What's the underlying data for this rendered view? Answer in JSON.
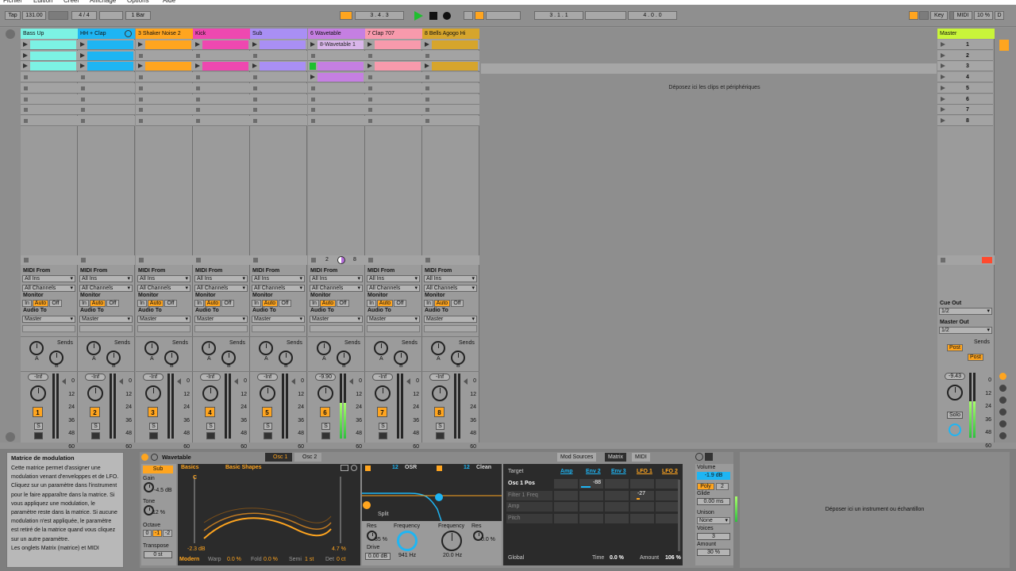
{
  "menu": [
    "Fichier",
    "Édition",
    "Créer",
    "Affichage",
    "Options",
    "Aide"
  ],
  "transport": {
    "tap": "Tap",
    "tempo": "131.00",
    "sig": "4 / 4",
    "rec_mode": "1 Bar",
    "position": "3 . 4 . 3",
    "loop_start": "3 . 1 . 1",
    "loop_len": "4 . 0 . 0",
    "key": "Key",
    "midi": "MIDI",
    "cpu": "10 %",
    "d": "D"
  },
  "tracks": [
    {
      "name": "Bass Up",
      "color": "#7cf2e4",
      "num": "1",
      "vol": "-Inf",
      "clips": [
        0,
        1,
        2
      ],
      "clip_label": ""
    },
    {
      "name": "HH + Clap",
      "color": "#1eb5f3",
      "num": "2",
      "vol": "-Inf",
      "clips": [
        0,
        1,
        2
      ],
      "clip_label": ""
    },
    {
      "name": "3 Shaker Noise 2",
      "color": "#ffa51f",
      "num": "3",
      "vol": "-Inf",
      "clips": [
        0,
        2
      ],
      "clip_label": ""
    },
    {
      "name": "Kick",
      "color": "#ee48b0",
      "num": "4",
      "vol": "-Inf",
      "clips": [
        0,
        2
      ],
      "clip_label": ""
    },
    {
      "name": "Sub",
      "color": "#a98ff4",
      "num": "5",
      "vol": "-Inf",
      "clips": [
        0,
        2
      ],
      "clip_label": ""
    },
    {
      "name": "6 Wavetable",
      "color": "#c57fe2",
      "num": "6",
      "vol": "-9.90",
      "clips": [
        0,
        2,
        3
      ],
      "clip_label": "8-Wavetable 1"
    },
    {
      "name": "7 Clap 707",
      "color": "#f89aac",
      "num": "7",
      "vol": "-Inf",
      "clips": [
        0,
        2
      ],
      "clip_label": ""
    },
    {
      "name": "8 Bells Agogo Hi",
      "color": "#d6a52c",
      "num": "8",
      "vol": "-Inf",
      "clips": [
        0,
        2
      ],
      "clip_label": ""
    }
  ],
  "io": {
    "midi_from": "MIDI From",
    "all_ins": "All Ins",
    "all_channels": "All Channels",
    "monitor": "Monitor",
    "in": "In",
    "auto": "Auto",
    "off": "Off",
    "audio_to": "Audio To",
    "master": "Master",
    "sends": "Sends",
    "a": "A",
    "b": "B",
    "s": "S"
  },
  "scale": [
    "0",
    "12",
    "24",
    "36",
    "48",
    "60"
  ],
  "wavetable_status": {
    "left": "2",
    "right": "8"
  },
  "drop_text": "Déposez ici les clips et périphériques",
  "master": {
    "name": "Master",
    "scenes": [
      "1",
      "2",
      "3",
      "4",
      "5",
      "6",
      "7",
      "8"
    ],
    "cue_out": "Cue Out",
    "cue_val": "1/2",
    "master_out": "Master Out",
    "master_val": "1/2",
    "sends": "Sends",
    "post": "Post",
    "vol": "-9.43",
    "solo": "Solo"
  },
  "info": {
    "title": "Matrice de modulation",
    "body": "Cette matrice permet d'assigner une modulation venant d'enveloppes et de LFO. Cliquez sur un paramètre dans l'instrument pour le faire apparaître dans la matrice. Si vous appliquez une modulation, le paramètre reste dans la matrice. Si aucune modulation n'est appliquée, le paramètre est retiré de la matrice quand vous cliquez sur un autre paramètre.",
    "footer": "Les onglets Matrix (matrice) et MIDI"
  },
  "wt": {
    "title": "Wavetable",
    "osc1": "Osc 1",
    "osc2": "Osc 2",
    "sub": "Sub",
    "gain": "Gain",
    "gain_val": "-4.5 dB",
    "tone": "Tone",
    "tone_val": "12 %",
    "octave": "Octave",
    "oct0": "0",
    "octm1": "-1",
    "octm2": "-2",
    "transpose": "Transpose",
    "transpose_val": "0 st",
    "cat": "Basics",
    "shape": "Basic Shapes",
    "note": "C",
    "level": "-2.3 dB",
    "pos": "4.7 %",
    "mode": "Modern",
    "warp": "Warp",
    "warp_val": "0.0 %",
    "fold": "Fold",
    "fold_val": "0.0 %",
    "semi": "Semi",
    "semi_val": "1 st",
    "det": "Det",
    "det_val": "0 ct",
    "f1": "12",
    "osr": "OSR",
    "f2": "12",
    "clean": "Clean",
    "split": "Split",
    "res": "Res",
    "res_val": "35 %",
    "freq": "Frequency",
    "freq_val": "941 Hz",
    "drive": "Drive",
    "drive_val": "0.00 dB",
    "freqres": "Frequency",
    "freqres2": "Res",
    "freqres_val": "20.0 Hz",
    "res2_val": "0.0 %"
  },
  "matrix": {
    "tabs": [
      "Mod Sources",
      "Matrix",
      "MIDI"
    ],
    "target": "Target",
    "cols": [
      "Amp",
      "Env 2",
      "Env 3",
      "LFO 1",
      "LFO 2"
    ],
    "rows": [
      "Osc 1 Pos",
      "Filter 1 Freq",
      "Amp",
      "Pitch"
    ],
    "v1": "-88",
    "v2": "-27",
    "global": "Global",
    "time": "Time",
    "time_val": "0.0 %",
    "amount": "Amount",
    "amount_val": "106 %"
  },
  "voice": {
    "volume": "Volume",
    "volume_val": "-1.9 dB",
    "poly": "Poly",
    "poly_n": "2",
    "glide": "Glide",
    "glide_val": "0.00 ms",
    "unison": "Unison",
    "unison_val": "None",
    "voices": "Voices",
    "voices_val": "3",
    "amount": "Amount",
    "amount_val": "30 %"
  },
  "drop_instr": "Déposer ici un instrument ou échantillon"
}
